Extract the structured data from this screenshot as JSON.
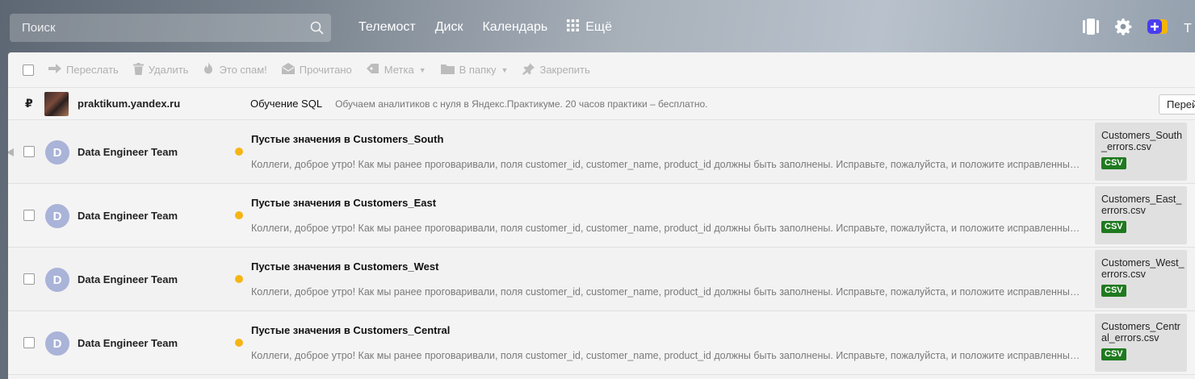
{
  "header": {
    "search_placeholder": "Поиск",
    "nav": [
      {
        "label": "Телемост"
      },
      {
        "label": "Диск"
      },
      {
        "label": "Календарь"
      },
      {
        "label": "Ещё"
      }
    ],
    "truncated_text": "Т"
  },
  "toolbar": {
    "items": [
      {
        "label": "Переслать",
        "icon": "forward-icon"
      },
      {
        "label": "Удалить",
        "icon": "trash-icon"
      },
      {
        "label": "Это спам!",
        "icon": "fire-icon"
      },
      {
        "label": "Прочитано",
        "icon": "envelope-open-icon"
      },
      {
        "label": "Метка",
        "icon": "tag-icon"
      },
      {
        "label": "В папку",
        "icon": "folder-icon"
      },
      {
        "label": "Закрепить",
        "icon": "pin-icon"
      }
    ]
  },
  "ad": {
    "currency_symbol": "₽",
    "sender": "praktikum.yandex.ru",
    "title": "Обучение SQL",
    "text": "Обучаем аналитиков с нуля в Яндекс.Практикуме. 20 часов практики – бесплатно.",
    "button_label": "Перейти"
  },
  "messages": [
    {
      "avatar": "D",
      "sender": "Data Engineer Team",
      "subject": "Пустые значения в Customers_South",
      "snippet": "Коллеги, доброе утро! Как мы ранее проговаривали, поля customer_id, customer_name, product_id должны быть заполнены. Исправьте, пожалуйста, и положите исправленные данные",
      "attachment": "Customers_South_errors.csv",
      "attachment_type": "CSV"
    },
    {
      "avatar": "D",
      "sender": "Data Engineer Team",
      "subject": "Пустые значения в Customers_East",
      "snippet": "Коллеги, доброе утро! Как мы ранее проговаривали, поля customer_id, customer_name, product_id должны быть заполнены. Исправьте, пожалуйста, и положите исправленные данные",
      "attachment": "Customers_East_errors.csv",
      "attachment_type": "CSV"
    },
    {
      "avatar": "D",
      "sender": "Data Engineer Team",
      "subject": "Пустые значения в Customers_West",
      "snippet": "Коллеги, доброе утро! Как мы ранее проговаривали, поля customer_id, customer_name, product_id должны быть заполнены. Исправьте, пожалуйста, и положите исправленные данные",
      "attachment": "Customers_West_errors.csv",
      "attachment_type": "CSV"
    },
    {
      "avatar": "D",
      "sender": "Data Engineer Team",
      "subject": "Пустые значения в Customers_Central",
      "snippet": "Коллеги, доброе утро! Как мы ранее проговаривали, поля customer_id, customer_name, product_id должны быть заполнены. Исправьте, пожалуйста, и положите исправленные данные",
      "attachment": "Customers_Central_errors.csv",
      "attachment_type": "CSV"
    }
  ],
  "colors": {
    "unread_dot": "#f6b515",
    "csv_badge": "#1f7a1f",
    "avatar": "#aab3d8"
  }
}
